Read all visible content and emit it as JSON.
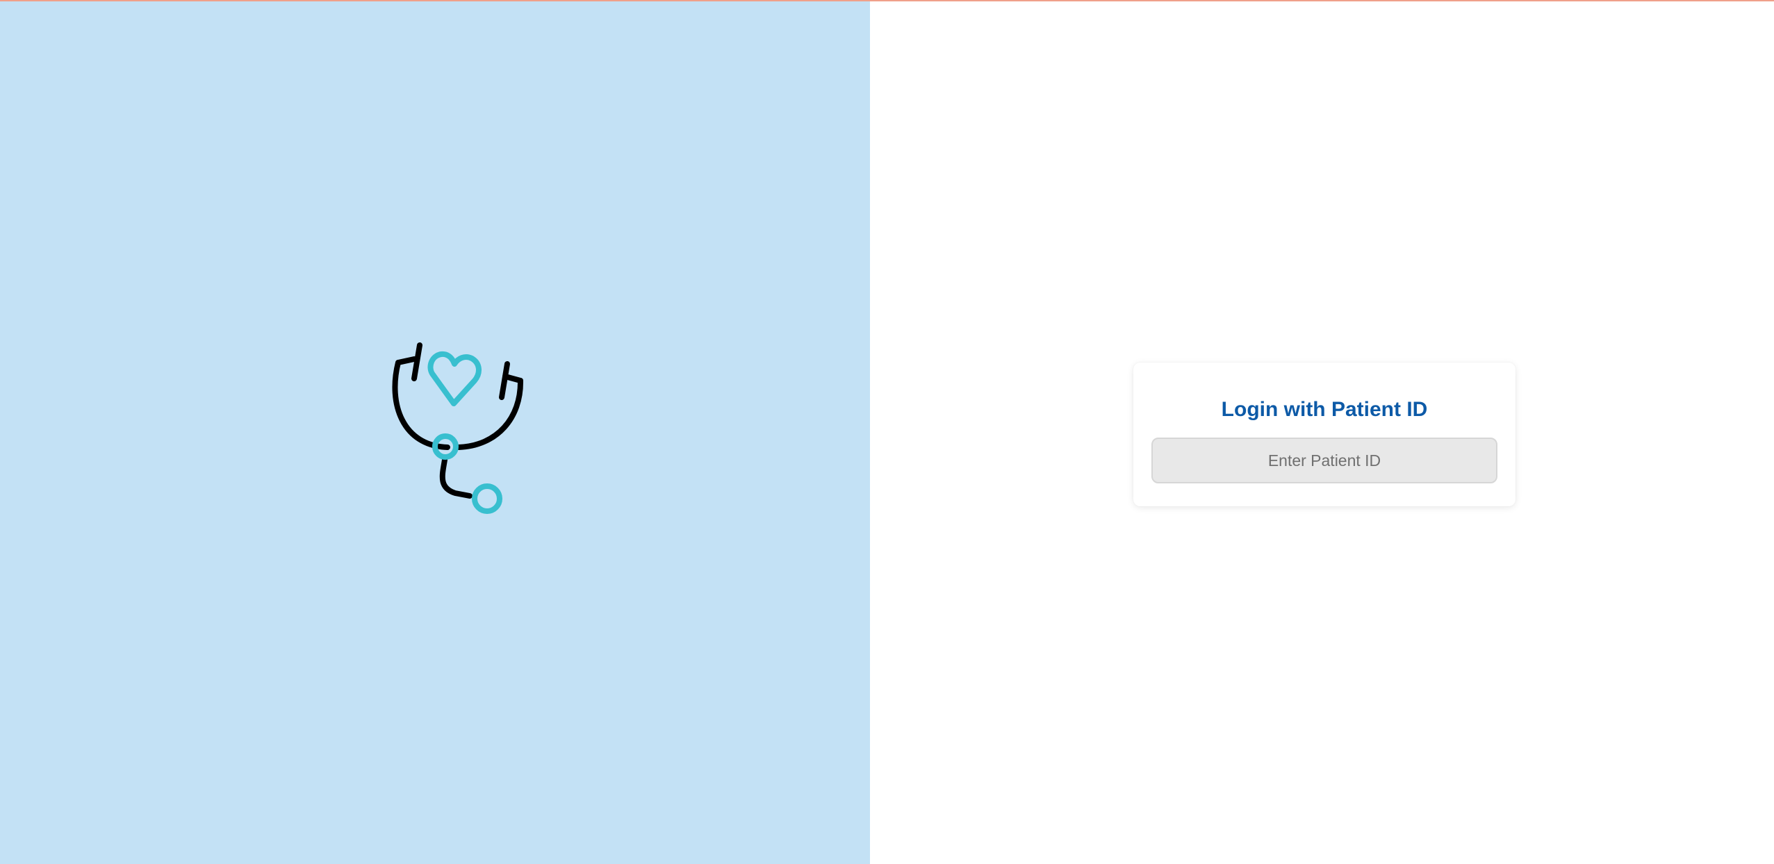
{
  "colors": {
    "top_accent": "#f0a08a",
    "left_panel_bg": "#c3e1f5",
    "title_color": "#0d5aa7",
    "logo_teal": "#38bfcf",
    "logo_dark": "#000000"
  },
  "logo": {
    "icon": "stethoscope-heart-icon"
  },
  "login": {
    "title": "Login with Patient ID",
    "patient_id_placeholder": "Enter Patient ID",
    "patient_id_value": ""
  }
}
